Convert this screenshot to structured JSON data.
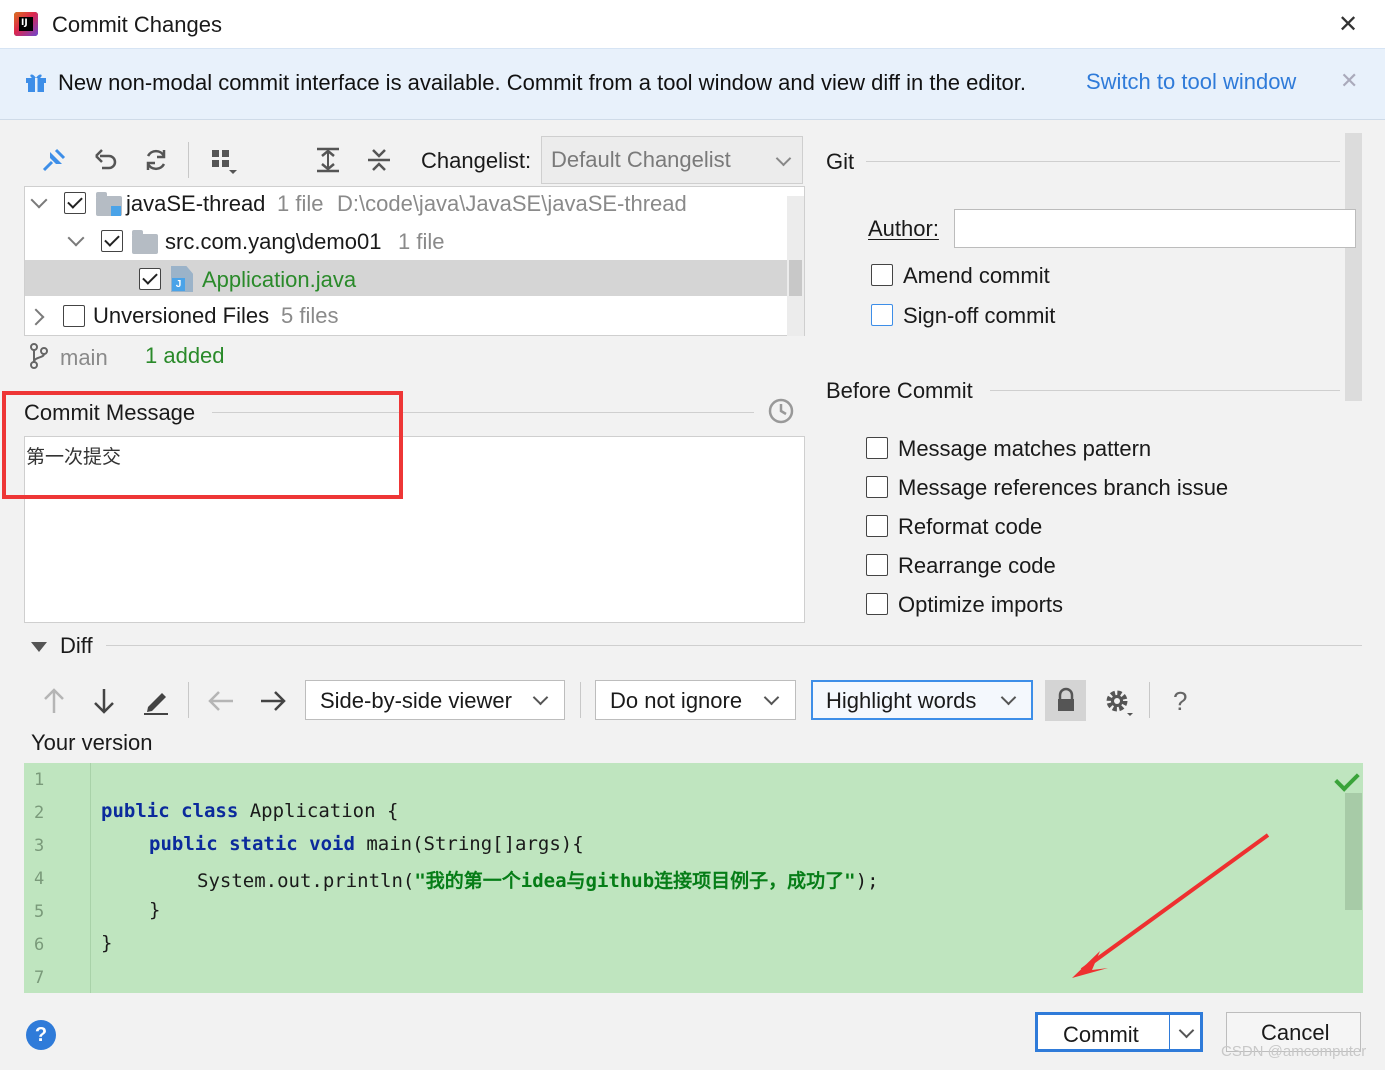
{
  "window": {
    "title": "Commit Changes",
    "close_glyph": "✕"
  },
  "banner": {
    "text": "New non-modal commit interface is available. Commit from a tool window and view diff in the editor.",
    "link": "Switch to tool window",
    "close_glyph": "✕"
  },
  "changes": {
    "changelist_label": "Changelist:",
    "changelist_value": "Default Changelist",
    "tree": [
      {
        "name": "javaSE-thread",
        "count": "1 file",
        "path": "D:\\code\\java\\JavaSE\\javaSE-thread",
        "checked": true
      },
      {
        "name": "src.com.yang\\demo01",
        "count": "1 file",
        "checked": true
      },
      {
        "name": "Application.java",
        "checked": true,
        "status_color": "#2a8a2a"
      },
      {
        "name": "Unversioned Files",
        "count": "5 files",
        "checked": false
      }
    ],
    "branch": "main",
    "summary": "1 added"
  },
  "commit_message": {
    "label": "Commit Message",
    "value": "第一次提交"
  },
  "git": {
    "section_label": "Git",
    "author_label": "Author:",
    "author_value": "",
    "options": [
      {
        "label": "Amend commit",
        "checked": false
      },
      {
        "label": "Sign-off commit",
        "checked": false
      }
    ]
  },
  "before_commit": {
    "section_label": "Before Commit",
    "options": [
      {
        "label": "Message matches pattern",
        "checked": false
      },
      {
        "label": "Message references branch issue",
        "checked": false
      },
      {
        "label": "Reformat code",
        "checked": false
      },
      {
        "label": "Rearrange code",
        "checked": false
      },
      {
        "label": "Optimize imports",
        "checked": false
      }
    ]
  },
  "diff": {
    "section_label": "Diff",
    "viewer": "Side-by-side viewer",
    "ignore": "Do not ignore",
    "highlight": "Highlight words",
    "help_glyph": "?",
    "your_version_label": "Your version",
    "line_numbers": [
      "1",
      "2",
      "3",
      "4",
      "5",
      "6",
      "7"
    ],
    "code": {
      "l2_kw": "public class",
      "l2_rest": " Application {",
      "l3_kw": "public static void",
      "l3_rest": " main(String[]args){",
      "l4_pre": "System.out.println(",
      "l4_str": "\"我的第一个idea与github连接项目例子，成功了\"",
      "l4_post": ");",
      "l5": "}",
      "l6": "}"
    },
    "added_color": "#bfe5bf"
  },
  "footer": {
    "help_glyph": "?",
    "commit_label": "Commit",
    "cancel_label": "Cancel"
  },
  "watermark": "CSDN @amcomputer",
  "icons": [
    "app-logo-icon",
    "gift-icon",
    "pin-icon",
    "undo-icon",
    "refresh-icon",
    "group-icon",
    "expand-all-icon",
    "collapse-all-icon",
    "branch-icon",
    "history-clock-icon",
    "arrow-up-icon",
    "arrow-down-icon",
    "edit-icon",
    "arrow-left-icon",
    "arrow-right-icon",
    "lock-icon",
    "gear-icon",
    "help-icon",
    "checkmark-icon"
  ]
}
